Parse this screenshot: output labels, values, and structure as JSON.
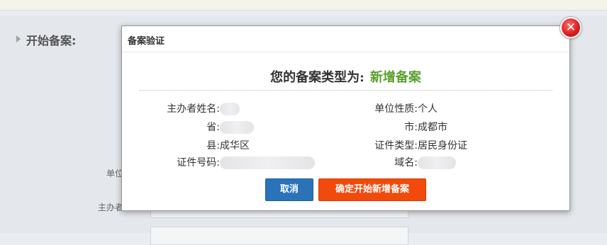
{
  "background": {
    "section_title": "开始备案:",
    "label_partial_1": "单位",
    "label_partial_2": "主办者"
  },
  "dialog": {
    "title": "备案验证",
    "close_symbol": "✕",
    "type_label": "您的备案类型为:",
    "type_value": "新增备案",
    "fields_left": [
      {
        "label": "主办者姓名:",
        "value": "(redacted)"
      },
      {
        "label": "省:",
        "value": "(redacted)"
      },
      {
        "label": "县:",
        "value": "成华区"
      },
      {
        "label": "证件号码:",
        "value": "(redacted)"
      }
    ],
    "fields_right": [
      {
        "label": "单位性质:",
        "value": "个人"
      },
      {
        "label": "市:",
        "value": "成都市"
      },
      {
        "label": "证件类型:",
        "value": "居民身份证"
      },
      {
        "label": "域名:",
        "value": "(redacted)"
      }
    ],
    "buttons": {
      "cancel": "取消",
      "confirm": "确定开始新增备案"
    }
  },
  "colors": {
    "type_value": "#5aa02c",
    "cancel_button": "#2b73b9",
    "confirm_button": "#f24a0c",
    "close_button": "#d91c1c"
  }
}
